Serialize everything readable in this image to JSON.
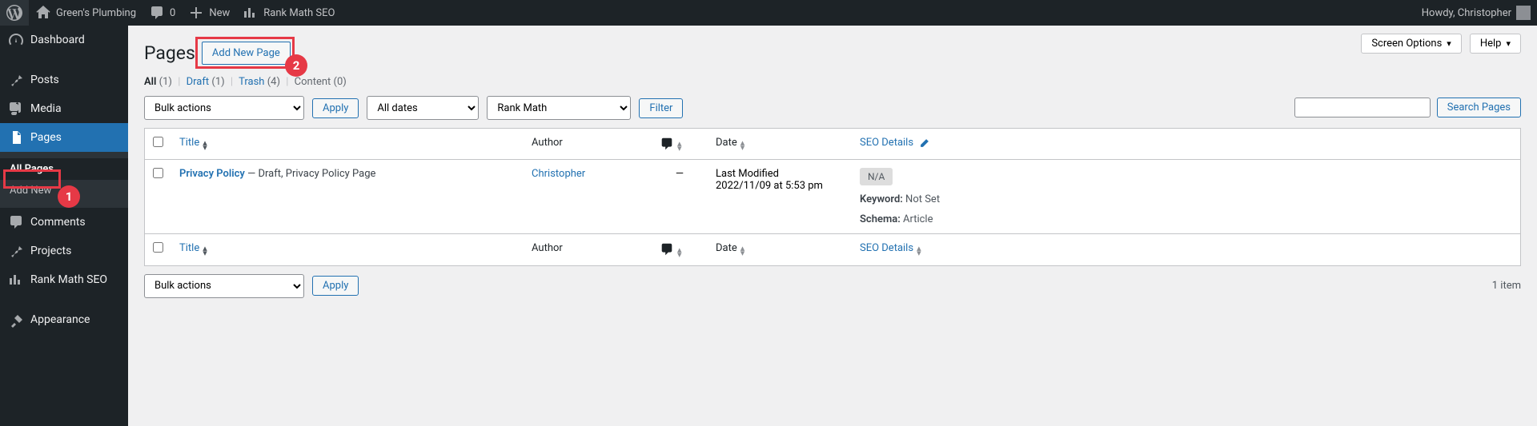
{
  "adminbar": {
    "site_name": "Green's Plumbing",
    "comments_count": "0",
    "new_label": "New",
    "rankmath_label": "Rank Math SEO",
    "howdy": "Howdy, Christopher"
  },
  "sidebar": {
    "dashboard": "Dashboard",
    "posts": "Posts",
    "media": "Media",
    "pages": "Pages",
    "all_pages": "All Pages",
    "add_new": "Add New",
    "comments": "Comments",
    "projects": "Projects",
    "rankmath": "Rank Math SEO",
    "appearance": "Appearance"
  },
  "top": {
    "screen_options": "Screen Options",
    "help": "Help"
  },
  "page": {
    "title": "Pages",
    "add_new_page": "Add New Page"
  },
  "filters_links": {
    "all_label": "All",
    "all_count": "(1)",
    "draft_label": "Draft",
    "draft_count": "(1)",
    "trash_label": "Trash",
    "trash_count": "(4)",
    "content_label": "Content",
    "content_count": "(0)"
  },
  "search": {
    "button": "Search Pages"
  },
  "filters": {
    "bulk_actions": "Bulk actions",
    "apply": "Apply",
    "all_dates": "All dates",
    "rankmath": "Rank Math",
    "filter": "Filter",
    "items_count": "1 item"
  },
  "columns": {
    "title": "Title",
    "author": "Author",
    "date": "Date",
    "seo": "SEO Details"
  },
  "row": {
    "title": "Privacy Policy",
    "state": " — Draft, Privacy Policy Page",
    "author": "Christopher",
    "comments": "—",
    "date_line1": "Last Modified",
    "date_line2": "2022/11/09 at 5:53 pm",
    "seo_badge": "N/A",
    "keyword_label": "Keyword:",
    "keyword_value": " Not Set",
    "schema_label": "Schema:",
    "schema_value": " Article"
  },
  "annotations": {
    "badge1": "1",
    "badge2": "2"
  }
}
